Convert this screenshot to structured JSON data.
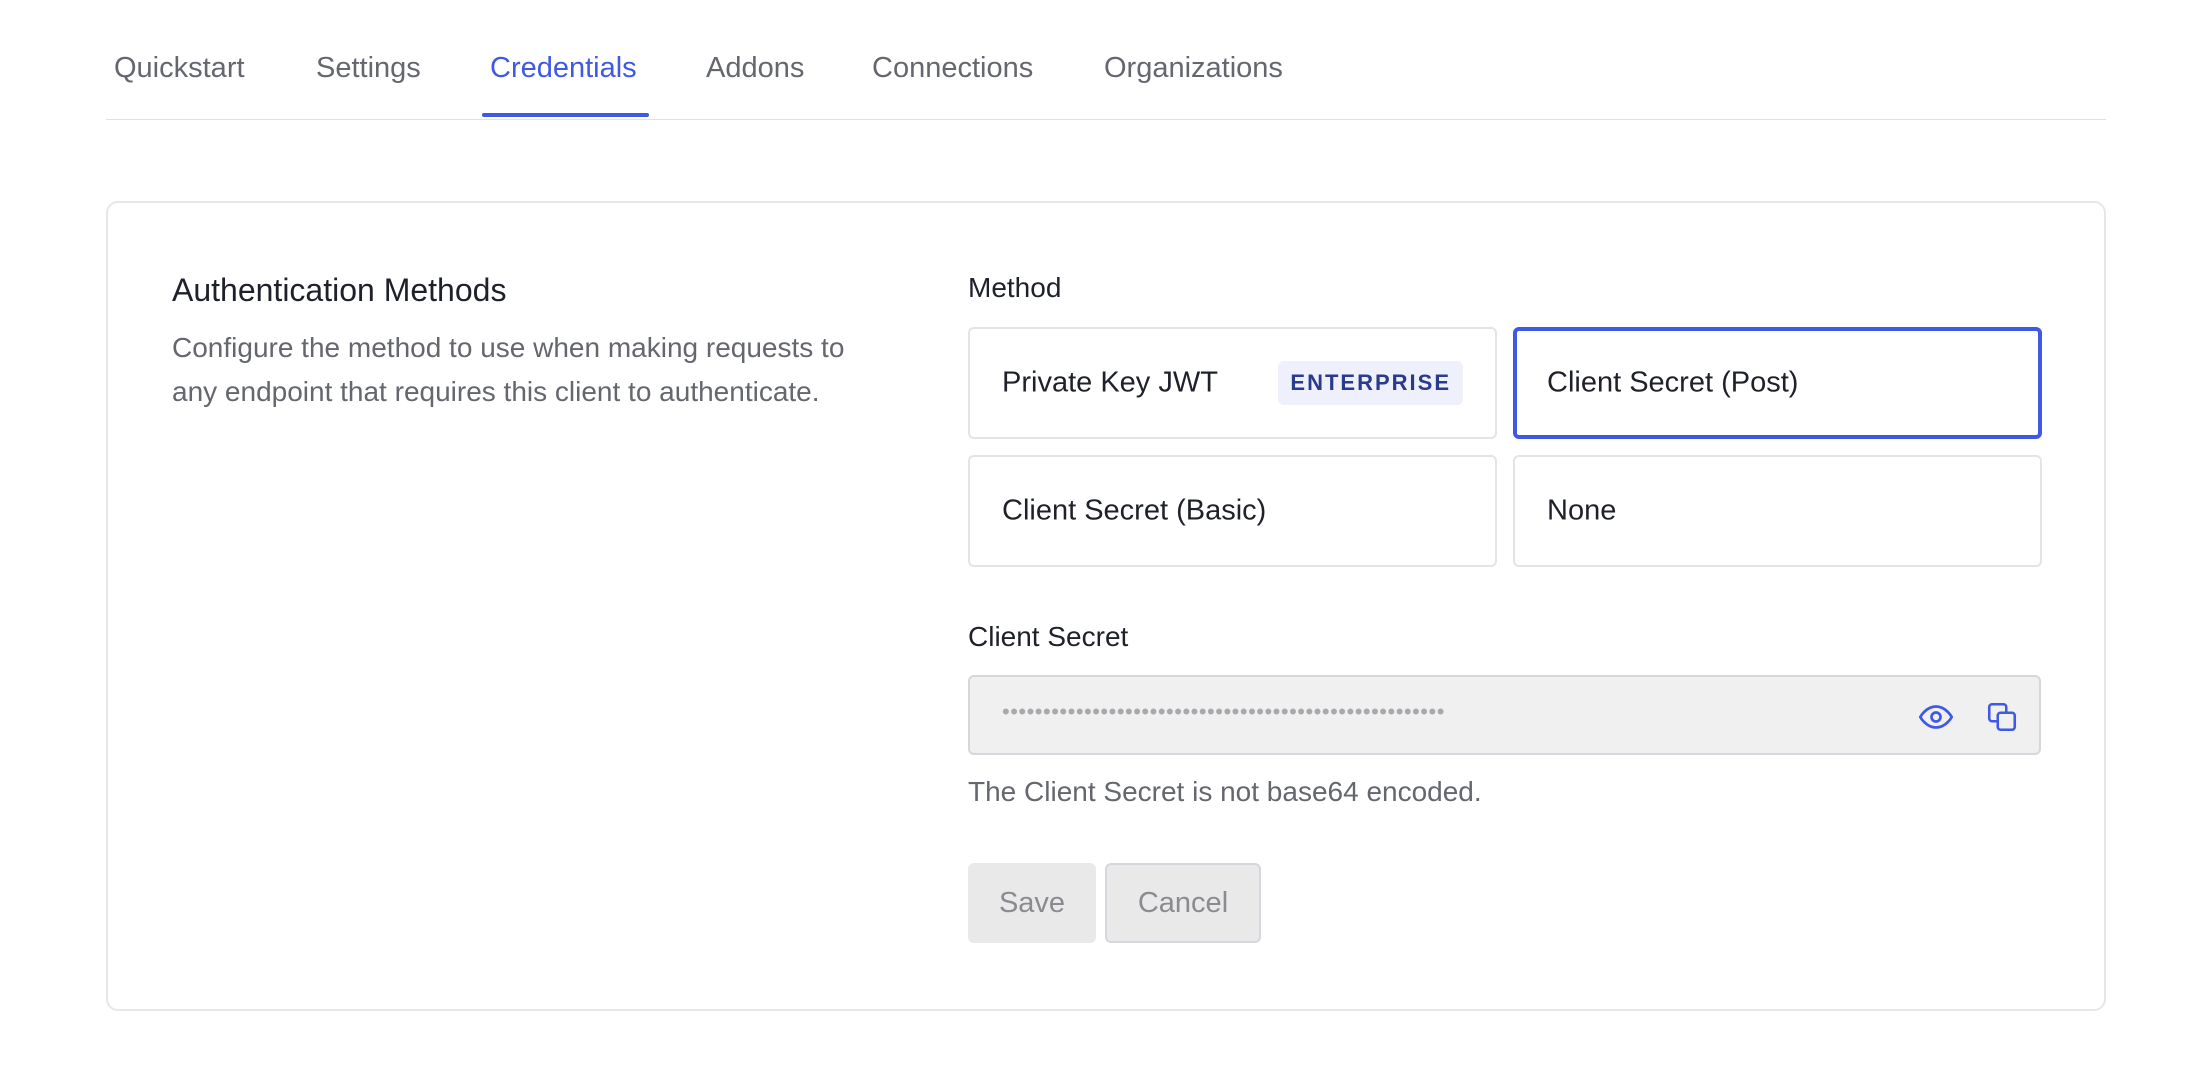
{
  "tabs": [
    {
      "label": "Quickstart"
    },
    {
      "label": "Settings"
    },
    {
      "label": "Credentials"
    },
    {
      "label": "Addons"
    },
    {
      "label": "Connections"
    },
    {
      "label": "Organizations"
    }
  ],
  "active_tab": "Credentials",
  "section": {
    "title": "Authentication Methods",
    "description": "Configure the method to use when making requests to any endpoint that requires this client to authenticate."
  },
  "method": {
    "label": "Method",
    "options": [
      {
        "label": "Private Key JWT",
        "badge": "ENTERPRISE",
        "selected": false
      },
      {
        "label": "Client Secret (Post)",
        "selected": true
      },
      {
        "label": "Client Secret (Basic)",
        "selected": false
      },
      {
        "label": "None",
        "selected": false
      }
    ]
  },
  "client_secret": {
    "label": "Client Secret",
    "value": "••••••••••••••••••••••••••••••••••••••••••••••••••••••",
    "helper": "The Client Secret is not base64 encoded.",
    "icons": [
      "eye-icon",
      "copy-icon"
    ]
  },
  "actions": {
    "save_label": "Save",
    "cancel_label": "Cancel"
  },
  "colors": {
    "accent": "#3f59e4",
    "muted_text": "#65676e",
    "badge_bg": "#eef0fb",
    "badge_text": "#2a3a8c"
  }
}
